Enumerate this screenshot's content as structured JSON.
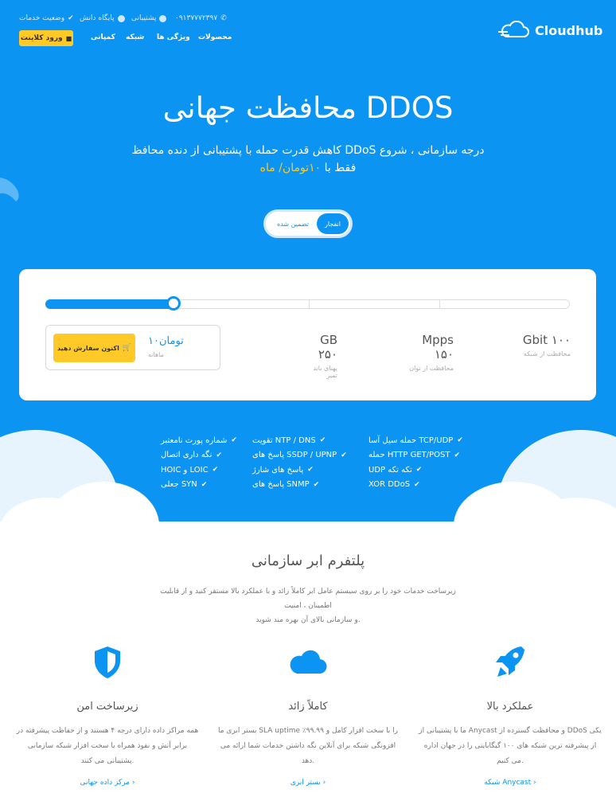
{
  "topbar": {
    "status": "وضعیت خدمات",
    "kb": "پایگاه دانش",
    "support": "پشتیبانی",
    "phone": "۰۹۱۳۷۷۷۲۳۹۷"
  },
  "brand": {
    "name": "Cloudhub"
  },
  "nav": {
    "client_login": "ورود کلاینت",
    "company": "کمپانی",
    "network": "شبکه",
    "features": "ویژگی ها",
    "products": "محصولات"
  },
  "hero": {
    "title": "محافظت جهانی DDOS",
    "subtitle_line1": "کاهش قدرت حمله با پشتیبانی از دنده محافظ DDoS درجه سازمانی ، شروع",
    "subtitle_prefix": "فقط با",
    "subtitle_price": "۱۰تومان/ ماه",
    "toggle_active": "انفجار",
    "toggle_inactive": "تضمین شده"
  },
  "pricing": {
    "slider_fraction": 0.24,
    "price": "۱۰تومان",
    "price_period": "ماهانه",
    "order_button": "اکنون سفارش دهید",
    "specs": [
      {
        "value": "Gbit ۱۰۰",
        "label": "محافظت از شبکه"
      },
      {
        "value": "Mpps ۱۵۰",
        "label": "محافظت از توان"
      },
      {
        "value": "GB ۲۵۰",
        "label": "پهنای باند تمیز"
      }
    ]
  },
  "features": {
    "col1": [
      "حمله سیل آسا TCP/UDP",
      "حمله HTTP GET/POST",
      "UDP تکه تکه",
      "XOR DDoS"
    ],
    "col2": [
      "تقویت NTP / DNS",
      "پاسخ های SSDP / UPNP",
      "پاسخ های شارژ",
      "پاسخ های SNMP"
    ],
    "col3": [
      "شماره پورت نامعتبر",
      "نگه داری اتصال",
      "HOIC و LOIC",
      "جعلی SYN"
    ]
  },
  "platform": {
    "title": "پلتفرم ابر سازمانی",
    "text_line1": "زیرساخت خدمات خود را بر روی سیستم عامل ابر کاملاً زائد و با عملکرد بالا مستقر کنید و از قابلیت اطمینان ، امنیت",
    "text_line2": "و سازمانی بالای آن بهره مند شوید."
  },
  "columns": [
    {
      "icon": "rocket-icon",
      "title": "عملکرد بالا",
      "text": "ما با پشتیبانی از Anycast و محافظت گسترده از DDoS یکی از پیشرفته ترین شبکه های ۱۰۰ گیگابایتی را در جهان اداره می کنیم.",
      "link": "شبکه Anycast"
    },
    {
      "icon": "cloud-icon",
      "title": "کاملاً زائد",
      "text": "بستر ابری ما SLA uptime ٪۹۹.۹۹ را با سخت افزار کامل و افزونگی شبکه برای آنلاین نگه داشتن خدمات شما ارائه می دهد.",
      "link": "بستر ابری"
    },
    {
      "icon": "shield-icon",
      "title": "زیرساخت امن",
      "text": "همه مراکز داده دارای درجه ۴ هستند و از حفاظت پیشرفته در برابر آتش و نفوذ همراه با سخت افزار شبکه سازمانی پشتیبانی می کنند.",
      "link": "مرکز داده جهانی"
    }
  ],
  "colors": {
    "primary": "#0b94f2",
    "accent": "#ffc928"
  }
}
